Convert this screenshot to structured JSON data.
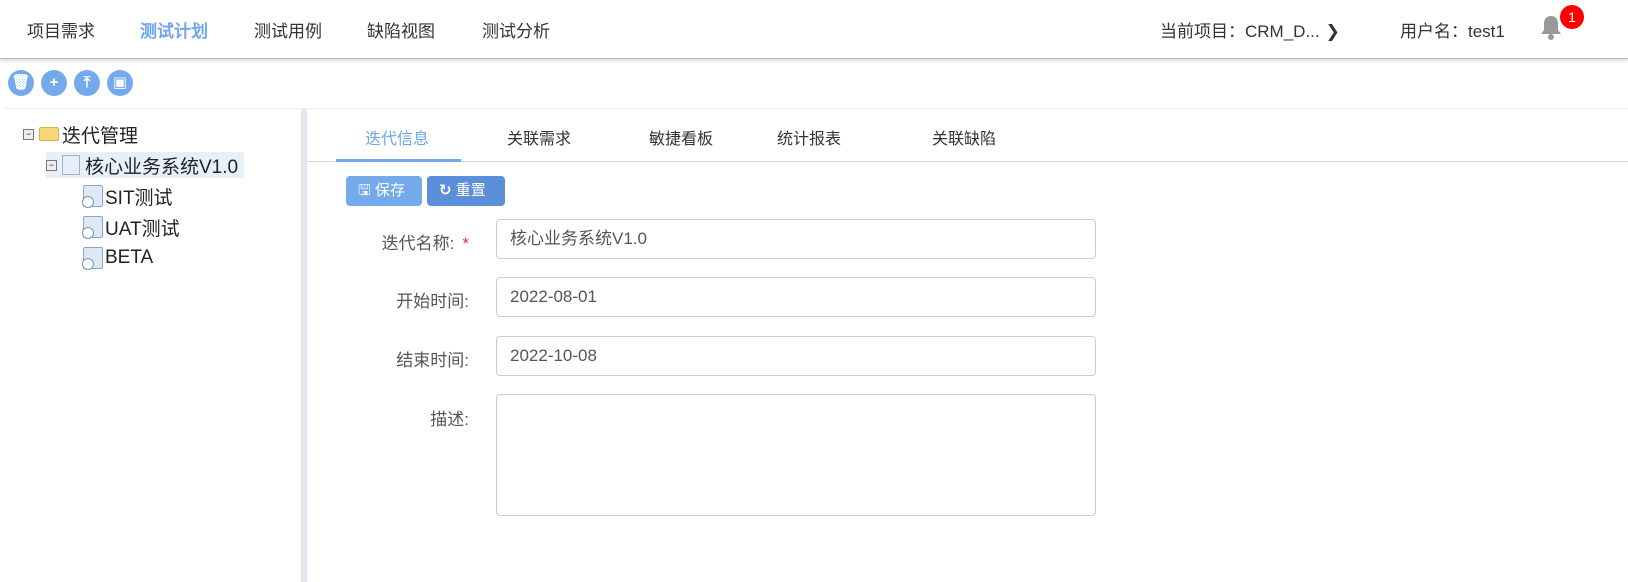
{
  "nav": {
    "items": [
      "项目需求",
      "测试计划",
      "测试用例",
      "缺陷视图",
      "测试分析"
    ],
    "active": 1
  },
  "header": {
    "project_label": "当前项目：CRM_D...",
    "user_label": "用户名：test1",
    "notification_count": "1"
  },
  "toolbar": {
    "icons": [
      "trash-icon",
      "plus-icon",
      "upload-icon",
      "export-icon"
    ]
  },
  "tree": {
    "root": "迭代管理",
    "iteration": "核心业务系统V1.0",
    "children": [
      "SIT测试",
      "UAT测试",
      "BETA"
    ]
  },
  "tabs": [
    "迭代信息",
    "关联需求",
    "敏捷看板",
    "统计报表",
    "关联缺陷"
  ],
  "actions": {
    "save": "保存",
    "reset": "重置"
  },
  "form": {
    "name_label": "迭代名称:",
    "required_mark": "*",
    "name_value": "核心业务系统V1.0",
    "start_label": "开始时间:",
    "start_value": "2022-08-01",
    "end_label": "结束时间:",
    "end_value": "2022-10-08",
    "desc_label": "描述:",
    "desc_value": ""
  },
  "colors": {
    "accent": "#74a9ec",
    "reset_button": "#5b8fd9",
    "badge": "#ff0000"
  }
}
